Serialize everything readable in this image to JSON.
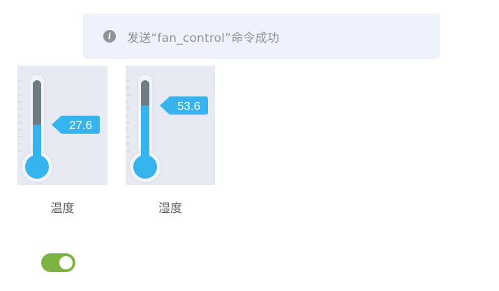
{
  "notification": {
    "icon": "info-icon",
    "message": "发送“fan_control”命令成功",
    "icon_color": "#909399",
    "background": "#edf2fc"
  },
  "gauges": [
    {
      "label": "温度",
      "value_text": "27.6",
      "fill_fraction": 0.42,
      "icon": "thermometer-icon"
    },
    {
      "label": "湿度",
      "value_text": "53.6",
      "fill_fraction": 0.67,
      "icon": "thermometer-icon"
    }
  ],
  "colors": {
    "mercury": "#35b4ee",
    "tube_empty": "#6f7c83",
    "switch_on": "#7cb342",
    "panel_bg": "#e7eaf2"
  },
  "toggle": {
    "state": "on"
  }
}
